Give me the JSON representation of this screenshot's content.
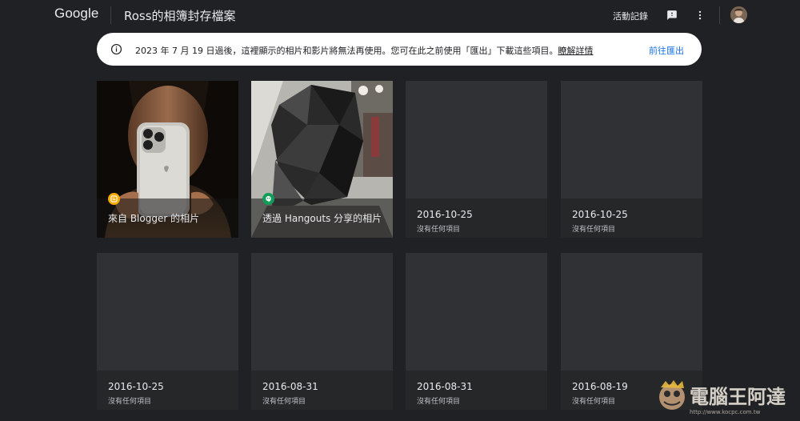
{
  "header": {
    "logo": "Google",
    "title": "Ross的相簿封存檔案",
    "activity_label": "活動記錄",
    "icons": [
      "feedback-icon",
      "more-vert-icon",
      "account-avatar"
    ]
  },
  "banner": {
    "icon": "info-icon",
    "message": "2023 年 7 月 19 日過後，這裡顯示的相片和影片將無法再使用。您可在此之前使用「匯出」下載這些項目。",
    "link": "瞭解詳情",
    "action": "前往匯出"
  },
  "albums": [
    {
      "title": "來自 Blogger 的相片",
      "subtitle": "",
      "badge": "blogger-icon",
      "badge_color": "#f9ab00"
    },
    {
      "title": "透過 Hangouts 分享的相片",
      "subtitle": "",
      "badge": "hangouts-icon",
      "badge_color": "#0f9d58"
    },
    {
      "title": "2016-10-25",
      "subtitle": "沒有任何項目"
    },
    {
      "title": "2016-10-25",
      "subtitle": "沒有任何項目"
    },
    {
      "title": "2016-10-25",
      "subtitle": "沒有任何項目"
    },
    {
      "title": "2016-08-31",
      "subtitle": "沒有任何項目"
    },
    {
      "title": "2016-08-31",
      "subtitle": "沒有任何項目"
    },
    {
      "title": "2016-08-19",
      "subtitle": "沒有任何項目"
    }
  ],
  "watermark": {
    "name": "電腦王阿達",
    "url": "http://www.kocpc.com.tw"
  },
  "colors": {
    "background": "#202124",
    "card": "#303134",
    "accent": "#1a73e8"
  }
}
